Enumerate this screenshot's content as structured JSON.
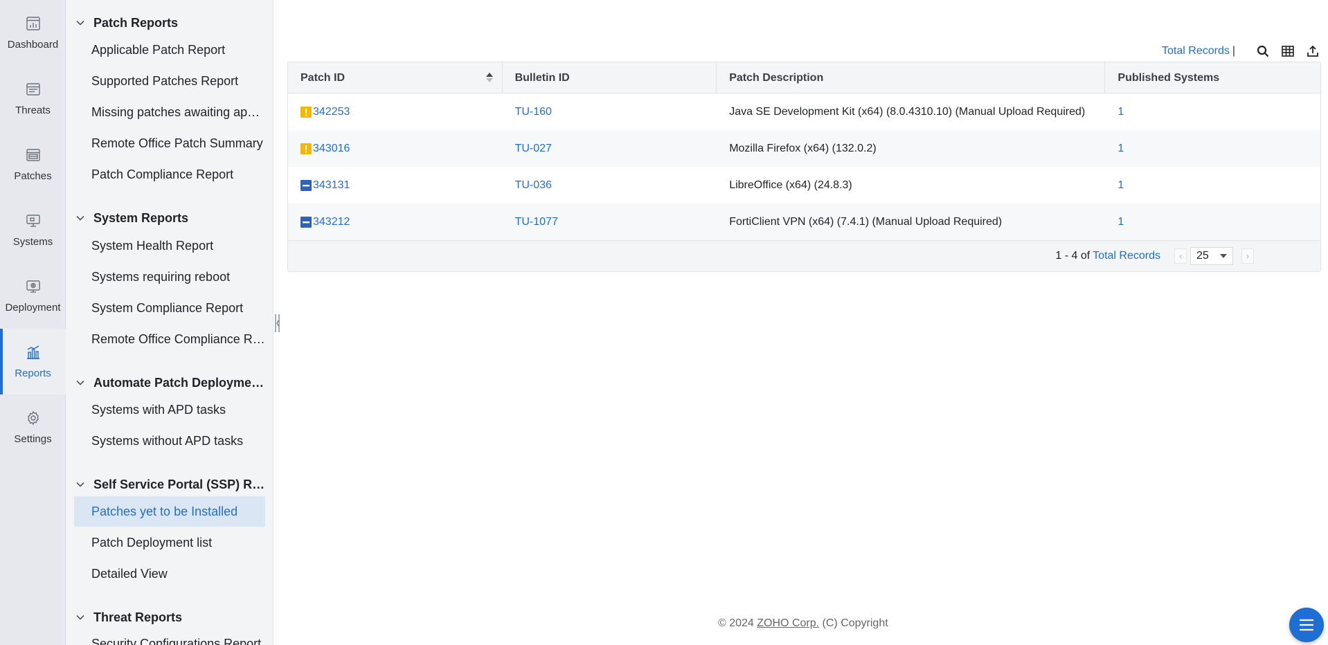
{
  "rail": {
    "items": [
      {
        "label": "Dashboard",
        "icon": "dashboard-icon"
      },
      {
        "label": "Threats",
        "icon": "threats-icon"
      },
      {
        "label": "Patches",
        "icon": "patches-icon"
      },
      {
        "label": "Systems",
        "icon": "systems-icon"
      },
      {
        "label": "Deployment",
        "icon": "deployment-icon"
      },
      {
        "label": "Reports",
        "icon": "reports-icon",
        "active": true
      },
      {
        "label": "Settings",
        "icon": "gear-icon"
      }
    ],
    "accent": "#1e6ed4"
  },
  "nav": {
    "sections": [
      {
        "title": "Patch Reports",
        "links": [
          "Applicable Patch Report",
          "Supported Patches Report",
          "Missing patches awaiting appr...",
          "Remote Office Patch Summary",
          "Patch Compliance Report"
        ]
      },
      {
        "title": "System Reports",
        "links": [
          "System Health Report",
          "Systems requiring reboot",
          "System Compliance Report",
          "Remote Office Compliance Re..."
        ]
      },
      {
        "title": "Automate Patch Deploymen...",
        "links": [
          "Systems with APD tasks",
          "Systems without APD tasks"
        ]
      },
      {
        "title": "Self Service Portal (SSP) Rep...",
        "links": [
          "Patches yet to be Installed",
          "Patch Deployment list",
          "Detailed View"
        ],
        "selected": "Patches yet to be Installed"
      },
      {
        "title": "Threat Reports",
        "links": [
          "Security Configurations Report"
        ]
      }
    ]
  },
  "toolbar": {
    "total_records_label": "Total Records",
    "separator": "|",
    "icons": [
      "search-icon",
      "column-chooser-icon",
      "export-icon"
    ]
  },
  "table": {
    "columns": [
      "Patch ID",
      "Bulletin ID",
      "Patch Description",
      "Published Systems"
    ],
    "rows": [
      {
        "severity": "important",
        "patch_id": "342253",
        "bulletin_id": "TU-160",
        "description": "Java SE Development Kit (x64) (8.0.4310.10) (Manual Upload Required)",
        "published": "1"
      },
      {
        "severity": "important",
        "patch_id": "343016",
        "bulletin_id": "TU-027",
        "description": "Mozilla Firefox (x64) (132.0.2)",
        "published": "1"
      },
      {
        "severity": "moderate",
        "patch_id": "343131",
        "bulletin_id": "TU-036",
        "description": "LibreOffice (x64) (24.8.3)",
        "published": "1"
      },
      {
        "severity": "moderate",
        "patch_id": "343212",
        "bulletin_id": "TU-1077",
        "description": "FortiClient VPN (x64) (7.4.1) (Manual Upload Required)",
        "published": "1"
      }
    ],
    "severity_colors": {
      "important": "#f5b800",
      "moderate": "#2f62b8"
    }
  },
  "pagination": {
    "range": "1 - 4 of",
    "total_records_label": "Total Records",
    "prev": "‹",
    "next": "›",
    "page_size": "25"
  },
  "footer": {
    "prefix": "© 2024",
    "company": "ZOHO Corp.",
    "suffix": "(C) Copyright"
  }
}
